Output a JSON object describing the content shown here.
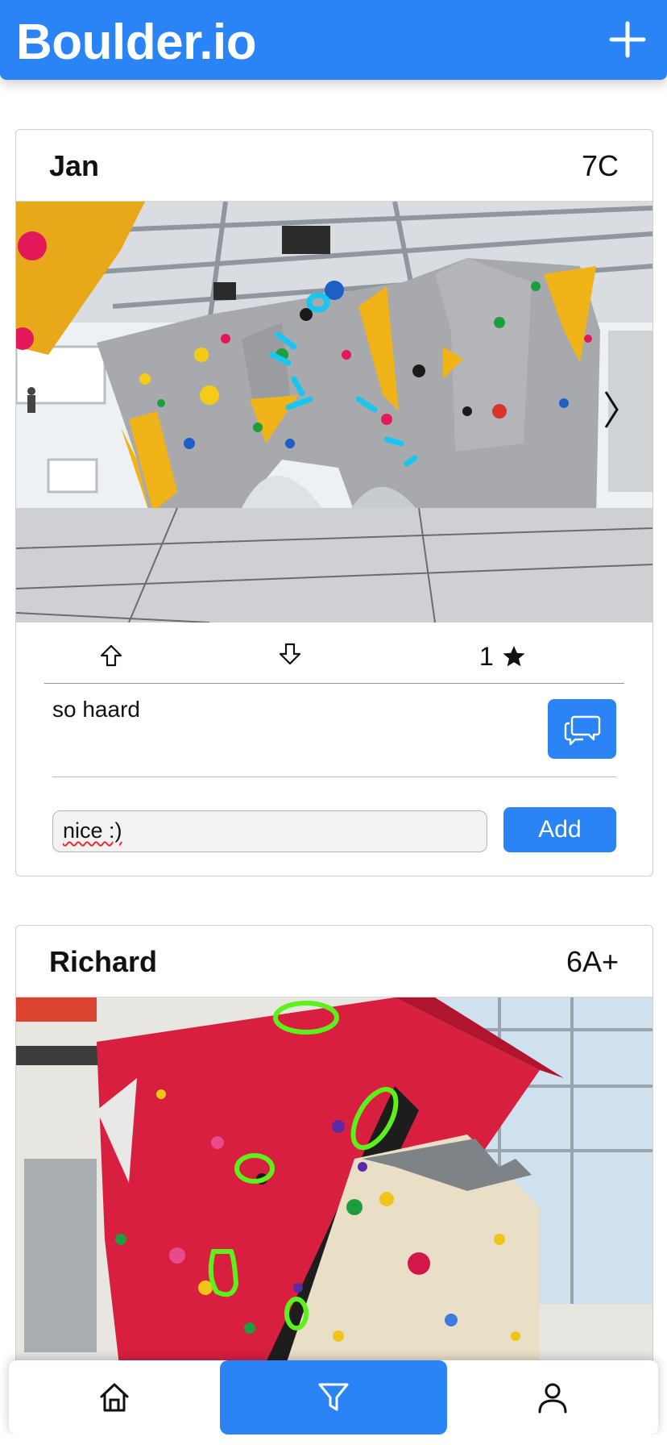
{
  "app": {
    "title": "Boulder.io",
    "brand_color": "#2a84f6"
  },
  "header": {
    "add_icon": "plus-icon"
  },
  "posts": [
    {
      "user": "Jan",
      "grade": "7C",
      "image": "indoor bouldering wall with cyan marked route",
      "upvote_icon": "arrow-up-icon",
      "downvote_icon": "arrow-down-icon",
      "rating_value": "1",
      "rating_icon": "star-icon",
      "comment": "so haard",
      "comments_icon": "chat-bubbles-icon",
      "new_comment_value": "nice :)",
      "add_label": "Add"
    },
    {
      "user": "Richard",
      "grade": "6A+",
      "image": "red bouldering wall with green marked route"
    }
  ],
  "nav": {
    "home_icon": "home-icon",
    "filter_icon": "filter-icon",
    "profile_icon": "user-icon",
    "active": "filter"
  }
}
